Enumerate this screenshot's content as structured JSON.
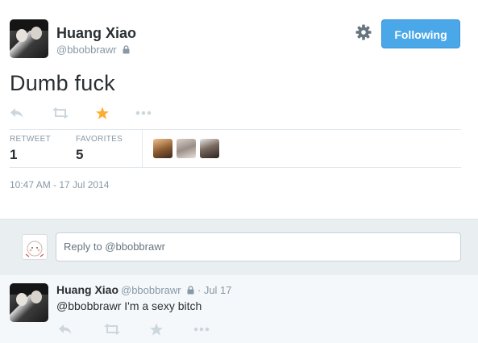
{
  "tweet": {
    "author": {
      "fullname": "Huang Xiao",
      "username": "@bbobbrawr",
      "protected": true
    },
    "follow_button": "Following",
    "text": "Dumb fuck",
    "stats": {
      "retweet_label": "RETWEET",
      "retweet_count": "1",
      "favorites_label": "FAVORITES",
      "favorites_count": "5"
    },
    "timestamp": "10:47 AM - 17 Jul 2014",
    "actions": [
      "reply-icon",
      "retweet-icon",
      "favorite-icon",
      "more-icon"
    ]
  },
  "reply_box": {
    "placeholder": "Reply to @bbobbrawr"
  },
  "reply": {
    "fullname": "Huang Xiao",
    "username": "@bbobbrawr",
    "date": "· Jul 17",
    "text": "@bbobbrawr I'm a sexy bitch",
    "actions": [
      "reply-icon",
      "retweet-icon",
      "favorite-icon",
      "more-icon"
    ]
  },
  "colors": {
    "accent": "#4aa7e8",
    "favorite_active": "#ffac33",
    "muted": "#8899a6",
    "text": "#292f33",
    "action_icon": "#ccd6dd"
  }
}
